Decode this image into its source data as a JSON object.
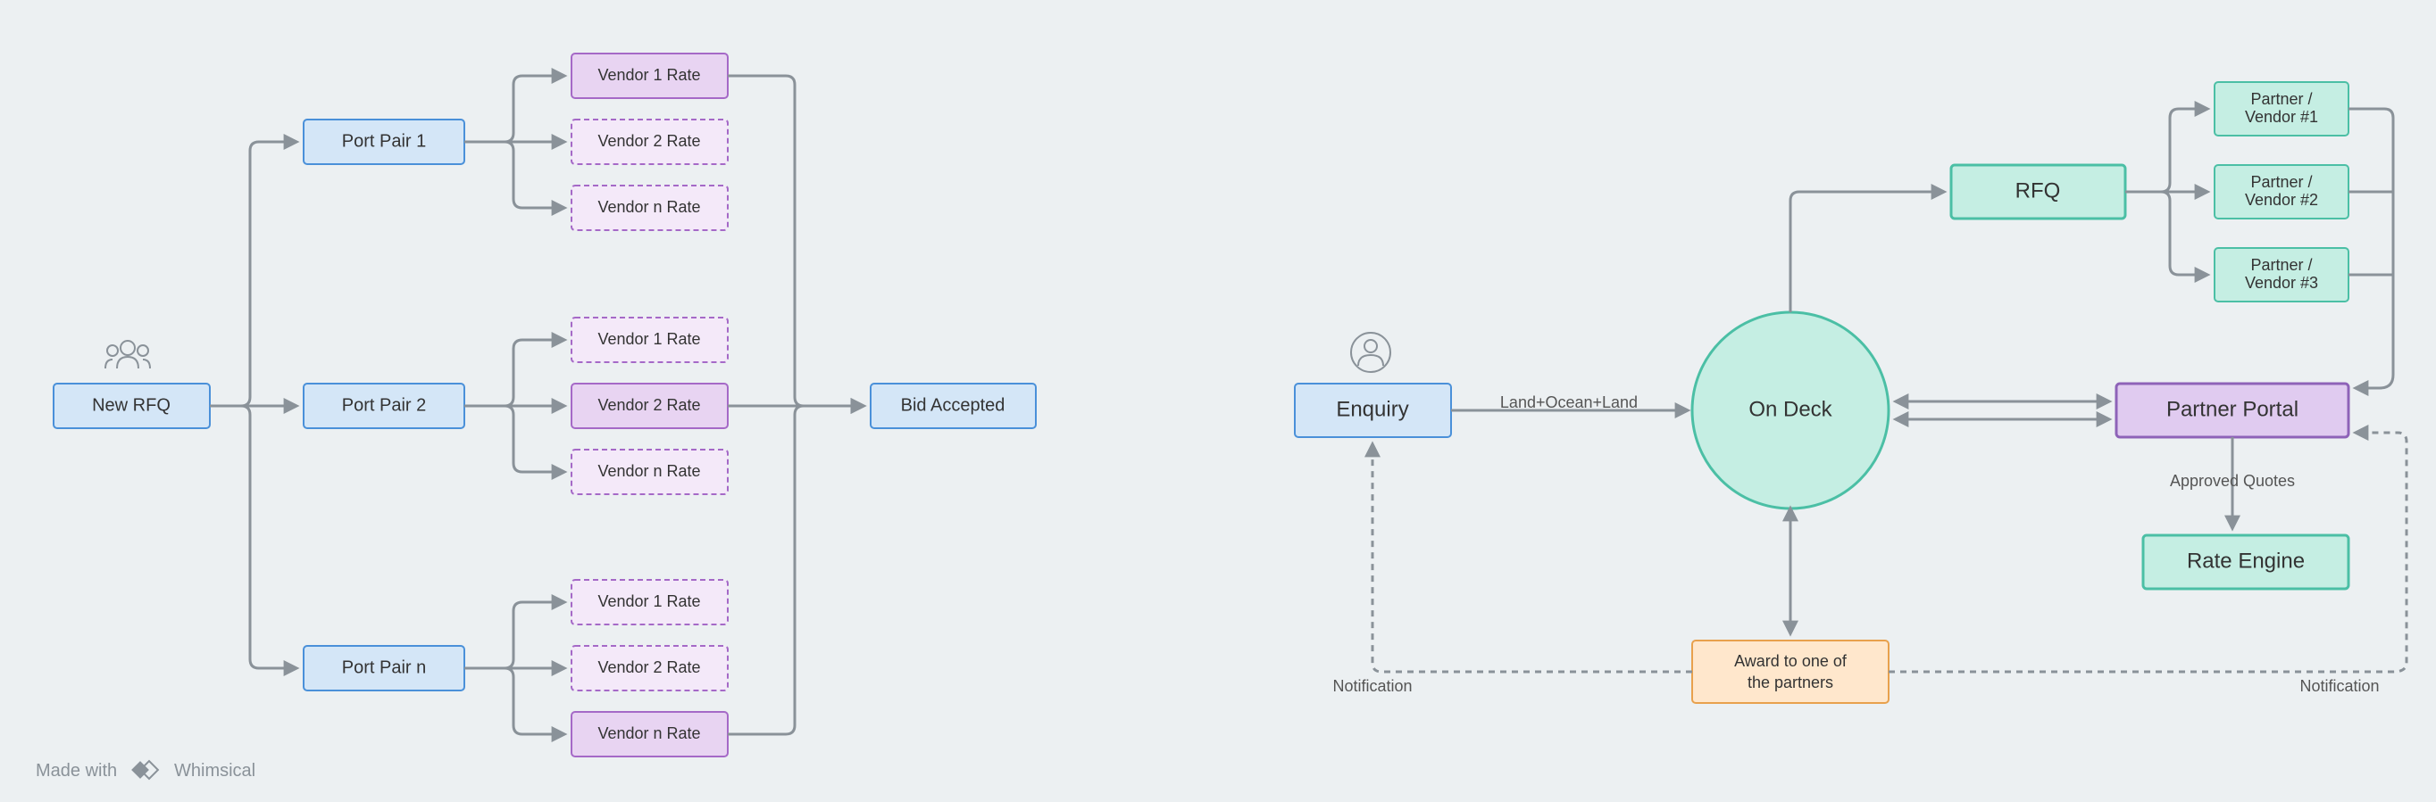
{
  "left": {
    "new_rfq": "New RFQ",
    "port_pairs": [
      "Port Pair 1",
      "Port Pair 2",
      "Port Pair n"
    ],
    "vendor_groups": [
      {
        "rates": [
          "Vendor 1 Rate",
          "Vendor 2 Rate",
          "Vendor n Rate"
        ],
        "solid_index": 0
      },
      {
        "rates": [
          "Vendor 1 Rate",
          "Vendor 2 Rate",
          "Vendor n Rate"
        ],
        "solid_index": 1
      },
      {
        "rates": [
          "Vendor 1 Rate",
          "Vendor 2 Rate",
          "Vendor n Rate"
        ],
        "solid_index": 2
      }
    ],
    "bid_accepted": "Bid Accepted"
  },
  "right": {
    "enquiry": "Enquiry",
    "edge_enquiry_ondeck": "Land+Ocean+Land",
    "on_deck": "On Deck",
    "rfq": "RFQ",
    "partners": [
      "Partner / Vendor #1",
      "Partner / Vendor #2",
      "Partner / Vendor #3"
    ],
    "partner_portal": "Partner Portal",
    "approved_quotes": "Approved Quotes",
    "rate_engine": "Rate Engine",
    "award": {
      "line1": "Award to one of",
      "line2": "the partners"
    },
    "notification_left": "Notification",
    "notification_right": "Notification"
  },
  "footer": {
    "made_with": "Made with",
    "brand": "Whimsical"
  }
}
